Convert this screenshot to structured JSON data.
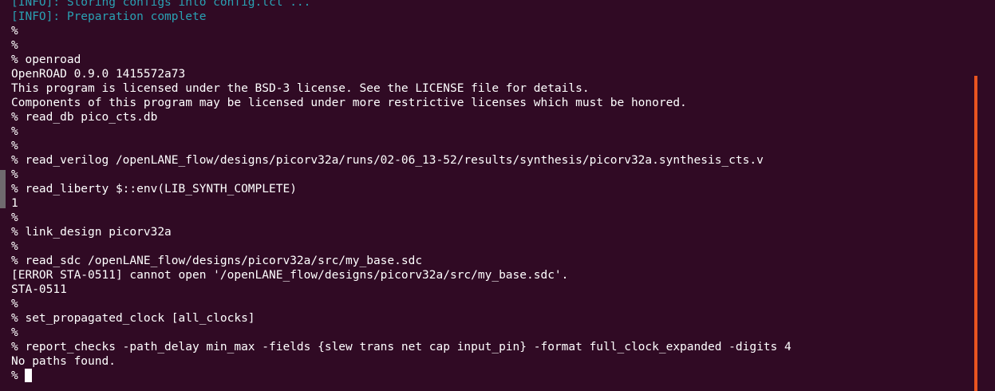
{
  "terminal": {
    "lines": [
      {
        "text": "[INFO]: Storing configs into config.tcl ...",
        "style": "info"
      },
      {
        "text": "[INFO]: Preparation complete",
        "style": "info"
      },
      {
        "text": "%"
      },
      {
        "text": "%"
      },
      {
        "text": "% openroad"
      },
      {
        "text": "OpenROAD 0.9.0 1415572a73"
      },
      {
        "text": "This program is licensed under the BSD-3 license. See the LICENSE file for details."
      },
      {
        "text": "Components of this program may be licensed under more restrictive licenses which must be honored."
      },
      {
        "text": "% read_db pico_cts.db"
      },
      {
        "text": "%"
      },
      {
        "text": "%"
      },
      {
        "text": "% read_verilog /openLANE_flow/designs/picorv32a/runs/02-06_13-52/results/synthesis/picorv32a.synthesis_cts.v"
      },
      {
        "text": "%"
      },
      {
        "text": "% read_liberty $::env(LIB_SYNTH_COMPLETE)"
      },
      {
        "text": "1"
      },
      {
        "text": "%"
      },
      {
        "text": "% link_design picorv32a"
      },
      {
        "text": "%"
      },
      {
        "text": "% read_sdc /openLANE_flow/designs/picorv32a/src/my_base.sdc"
      },
      {
        "text": "[ERROR STA-0511] cannot open '/openLANE_flow/designs/picorv32a/src/my_base.sdc'."
      },
      {
        "text": "STA-0511"
      },
      {
        "text": "%"
      },
      {
        "text": "% set_propagated_clock [all_clocks]"
      },
      {
        "text": "%"
      },
      {
        "text": "% report_checks -path_delay min_max -fields {slew trans net cap input_pin} -format full_clock_expanded -digits 4"
      },
      {
        "text": "No paths found."
      }
    ],
    "prompt": "% "
  },
  "colors": {
    "background": "#300a24",
    "foreground": "#ffffff",
    "info": "#2aa1b3",
    "scrollbar_thumb": "#e95420"
  }
}
